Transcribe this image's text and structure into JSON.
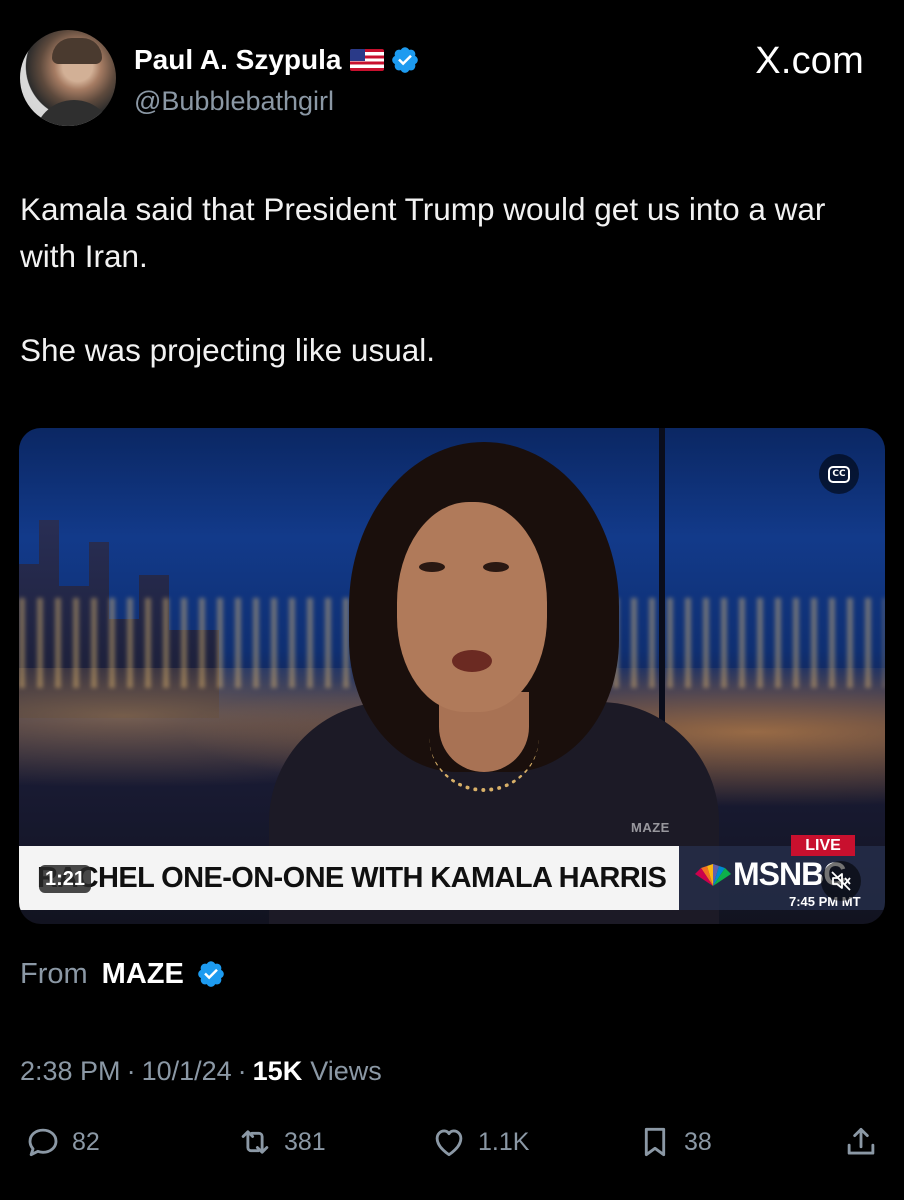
{
  "user": {
    "display_name": "Paul A. Szypula",
    "handle": "@Bubblebathgirl",
    "flag_icon": "us-flag-icon",
    "verified_icon": "verified-badge-icon",
    "verified_color": "#1d9bf0"
  },
  "site_label": "X.com",
  "tweet": {
    "paragraphs": [
      "Kamala said that President Trump would get us into a war with Iran.",
      "She was projecting like usual."
    ]
  },
  "video": {
    "timestamp": "1:21",
    "lower_third": "RACHEL ONE-ON-ONE WITH KAMALA HARRIS",
    "watermark": "MAZE",
    "live_badge": "LIVE",
    "network": "MSNBC",
    "network_time": "7:45 PM MT",
    "cc_label": "CC",
    "accent_live": "#c8102e"
  },
  "source": {
    "prefix": "From",
    "name": "MAZE"
  },
  "meta": {
    "time": "2:38 PM",
    "separator": "·",
    "date": "10/1/24",
    "views_count": "15K",
    "views_label": "Views"
  },
  "actions": {
    "replies": "82",
    "reposts": "381",
    "likes": "1.1K",
    "bookmarks": "38"
  },
  "colors": {
    "background": "#000000",
    "text": "#e7e9ea",
    "muted": "#8b98a5"
  }
}
